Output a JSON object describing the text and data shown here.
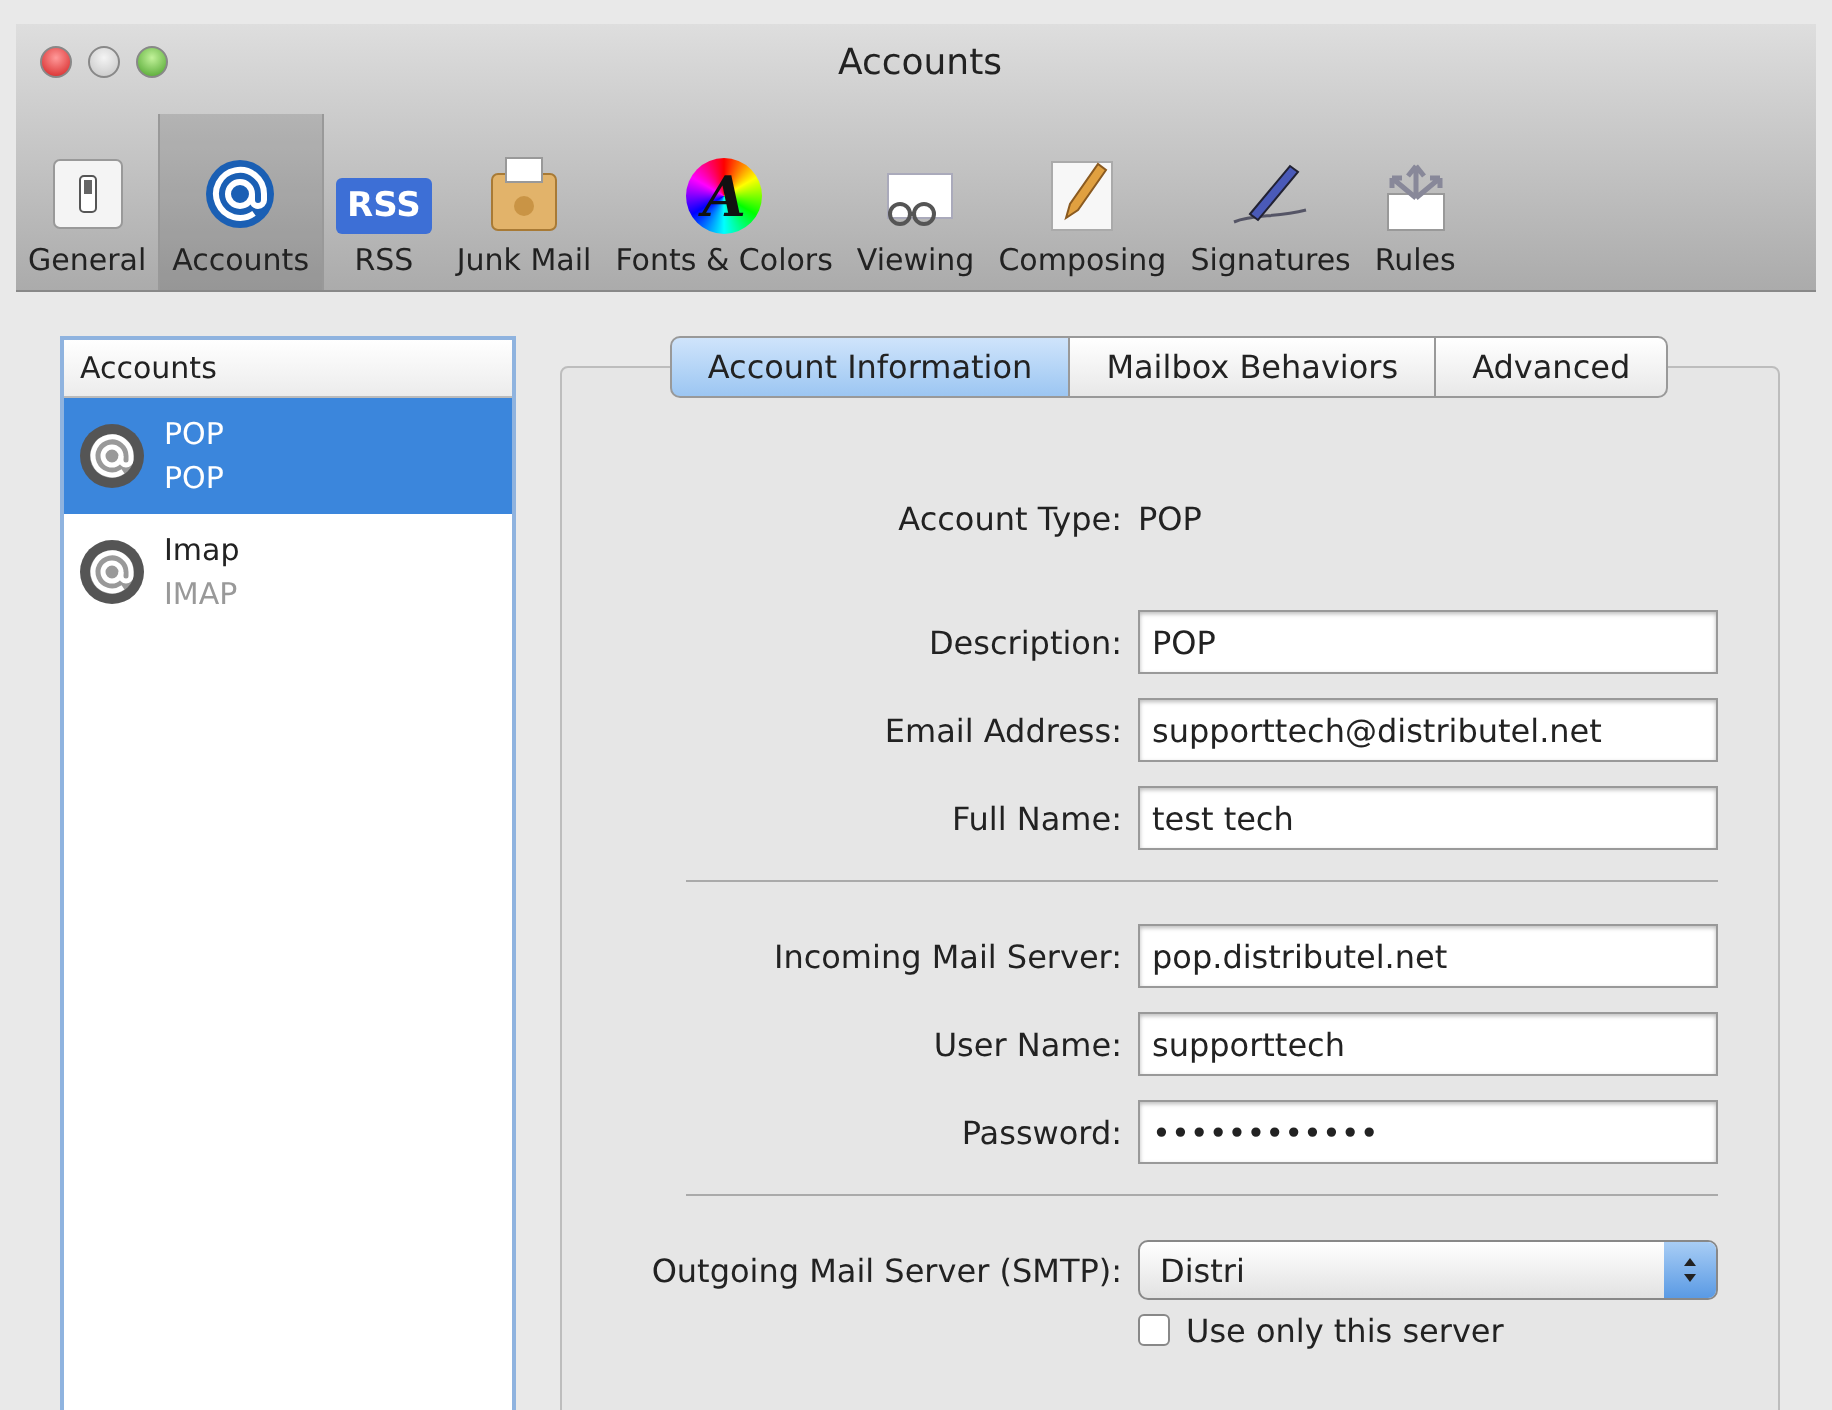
{
  "window": {
    "title": "Accounts"
  },
  "toolbar": [
    {
      "kind": "general",
      "label": "General",
      "selected": false
    },
    {
      "kind": "accounts",
      "label": "Accounts",
      "selected": true
    },
    {
      "kind": "rss",
      "label": "RSS",
      "badge": "RSS",
      "selected": false
    },
    {
      "kind": "junk",
      "label": "Junk Mail",
      "selected": false
    },
    {
      "kind": "fonts",
      "label": "Fonts & Colors",
      "glyph": "A",
      "selected": false
    },
    {
      "kind": "viewing",
      "label": "Viewing",
      "selected": false
    },
    {
      "kind": "composing",
      "label": "Composing",
      "selected": false
    },
    {
      "kind": "signatures",
      "label": "Signatures",
      "selected": false
    },
    {
      "kind": "rules",
      "label": "Rules",
      "selected": false
    }
  ],
  "sidebar": {
    "header": "Accounts",
    "items": [
      {
        "name": "POP",
        "type": "POP",
        "selected": true
      },
      {
        "name": "Imap",
        "type": "IMAP",
        "selected": false
      }
    ]
  },
  "tabs": [
    {
      "label": "Account Information",
      "selected": true
    },
    {
      "label": "Mailbox Behaviors",
      "selected": false
    },
    {
      "label": "Advanced",
      "selected": false
    }
  ],
  "account_type": {
    "label": "Account Type:",
    "value": "POP"
  },
  "groups": [
    [
      {
        "label": "Description:",
        "value": "POP"
      },
      {
        "label": "Email Address:",
        "value": "supporttech@distributel.net"
      },
      {
        "label": "Full Name:",
        "value": "test tech"
      }
    ],
    [
      {
        "label": "Incoming Mail Server:",
        "value": "pop.distributel.net"
      },
      {
        "label": "User Name:",
        "value": "supporttech"
      },
      {
        "label": "Password:",
        "value": "••••••••••••"
      }
    ]
  ],
  "smtp": {
    "label": "Outgoing Mail Server (SMTP):",
    "value": "Distri"
  },
  "use_only": {
    "label": "Use only this server",
    "checked": false
  }
}
